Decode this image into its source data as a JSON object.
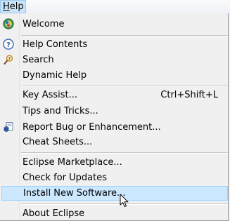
{
  "menubar": {
    "help_prefix": "",
    "help_underlined": "H",
    "help_rest": "elp"
  },
  "menu": {
    "items": [
      {
        "label": "Welcome",
        "icon": "welcome-icon"
      },
      {
        "label": "Help Contents",
        "icon": "help-contents-icon"
      },
      {
        "label": "Search",
        "icon": "search-icon"
      },
      {
        "label": "Dynamic Help"
      },
      {
        "label": "Key Assist...",
        "shortcut": "Ctrl+Shift+L"
      },
      {
        "label": "Tips and Tricks..."
      },
      {
        "label": "Report Bug or Enhancement...",
        "icon": "report-bug-icon"
      },
      {
        "label": "Cheat Sheets..."
      },
      {
        "label": "Eclipse Marketplace..."
      },
      {
        "label": "Check for Updates"
      },
      {
        "label": "Install New Software...",
        "highlighted": true
      },
      {
        "label": "About Eclipse"
      }
    ]
  },
  "colors": {
    "menu_background": "#f0f0f0",
    "highlight_background": "#cce8ff",
    "highlight_border": "#99d1ff",
    "menubar_active": "#cce4f7"
  }
}
